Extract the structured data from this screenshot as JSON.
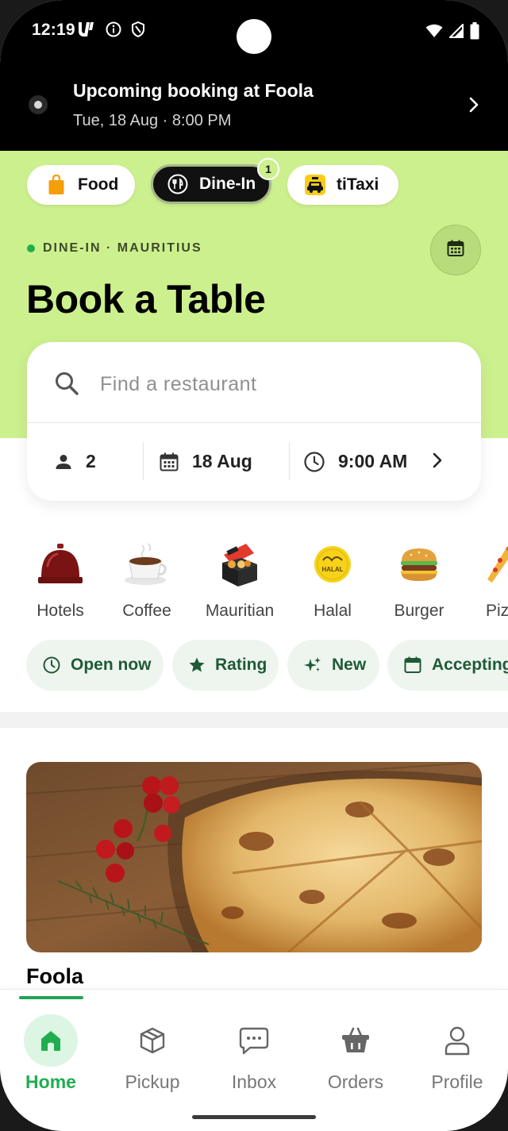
{
  "status_bar": {
    "time": "12:19"
  },
  "banner": {
    "title": "Upcoming booking at Foola",
    "subtitle": "Tue, 18 Aug · 8:00 PM"
  },
  "service_tabs": [
    {
      "label": "Food",
      "icon": "shopping-bag-icon",
      "color": "#f59e0b"
    },
    {
      "label": "Dine-In",
      "icon": "fork-knife-icon",
      "active": true,
      "badge": "1"
    },
    {
      "label": "tiTaxi",
      "icon": "taxi-icon",
      "color": "#facc15"
    }
  ],
  "region": "DINE-IN · MAURITIUS",
  "title": "Book a Table",
  "search": {
    "placeholder": "Find a restaurant"
  },
  "booking": {
    "guests": "2",
    "date": "18 Aug",
    "time": "9:00 AM"
  },
  "categories": [
    {
      "label": "Hotels",
      "icon": "service-bell-icon"
    },
    {
      "label": "Coffee",
      "icon": "coffee-cup-icon"
    },
    {
      "label": "Mauritian",
      "icon": "mauritian-food-box-icon"
    },
    {
      "label": "Halal",
      "icon": "halal-badge-icon",
      "badge_text": "HALAL"
    },
    {
      "label": "Burger",
      "icon": "burger-icon"
    },
    {
      "label": "Piz",
      "icon": "pizza-slice-icon"
    }
  ],
  "filters": [
    {
      "label": "Open now",
      "icon": "clock-icon"
    },
    {
      "label": "Rating",
      "icon": "star-icon"
    },
    {
      "label": "New",
      "icon": "sparkle-icon"
    },
    {
      "label": "Accepting",
      "icon": "calendar-icon"
    }
  ],
  "restaurant": {
    "name": "Foola",
    "image": "pizza-photo"
  },
  "bottom_nav": [
    {
      "label": "Home",
      "icon": "home-icon",
      "active": true
    },
    {
      "label": "Pickup",
      "icon": "package-icon"
    },
    {
      "label": "Inbox",
      "icon": "chat-bubble-icon"
    },
    {
      "label": "Orders",
      "icon": "basket-icon"
    },
    {
      "label": "Profile",
      "icon": "person-icon"
    }
  ],
  "colors": {
    "accent_green": "#1fae4f",
    "hero_bg": "#cdf08e",
    "chip_bg": "#eef5ee"
  }
}
